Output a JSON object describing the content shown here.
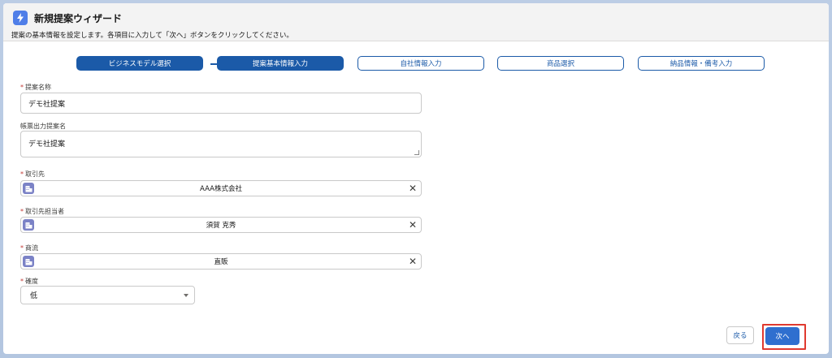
{
  "header": {
    "title": "新規提案ウィザード",
    "description": "提案の基本情報を設定します。各項目に入力して「次へ」ボタンをクリックしてください。",
    "icon": "lightning-icon"
  },
  "steps": [
    {
      "label": "ビジネスモデル選択",
      "state": "completed"
    },
    {
      "label": "提案基本情報入力",
      "state": "current"
    },
    {
      "label": "自社情報入力",
      "state": "pending"
    },
    {
      "label": "商品選択",
      "state": "pending"
    },
    {
      "label": "納品情報・備考入力",
      "state": "pending"
    }
  ],
  "form": {
    "proposal_name": {
      "label": "提案名称",
      "required": true,
      "value": "デモ社提案"
    },
    "report_name": {
      "label": "帳票出力提案名",
      "required": false,
      "value": "デモ社提案"
    },
    "account": {
      "label": "取引先",
      "required": true,
      "value": "AAA株式会社"
    },
    "contact": {
      "label": "取引先担当者",
      "required": true,
      "value": "須賀 克秀"
    },
    "channel": {
      "label": "商流",
      "required": true,
      "value": "直販"
    },
    "probability": {
      "label": "確度",
      "required": true,
      "value": "低"
    }
  },
  "footer": {
    "back_label": "戻る",
    "next_label": "次へ"
  },
  "colors": {
    "brand": "#1b5aa8",
    "primary_button": "#2f6fcf",
    "required": "#c23934",
    "highlight": "#e03a2f"
  }
}
